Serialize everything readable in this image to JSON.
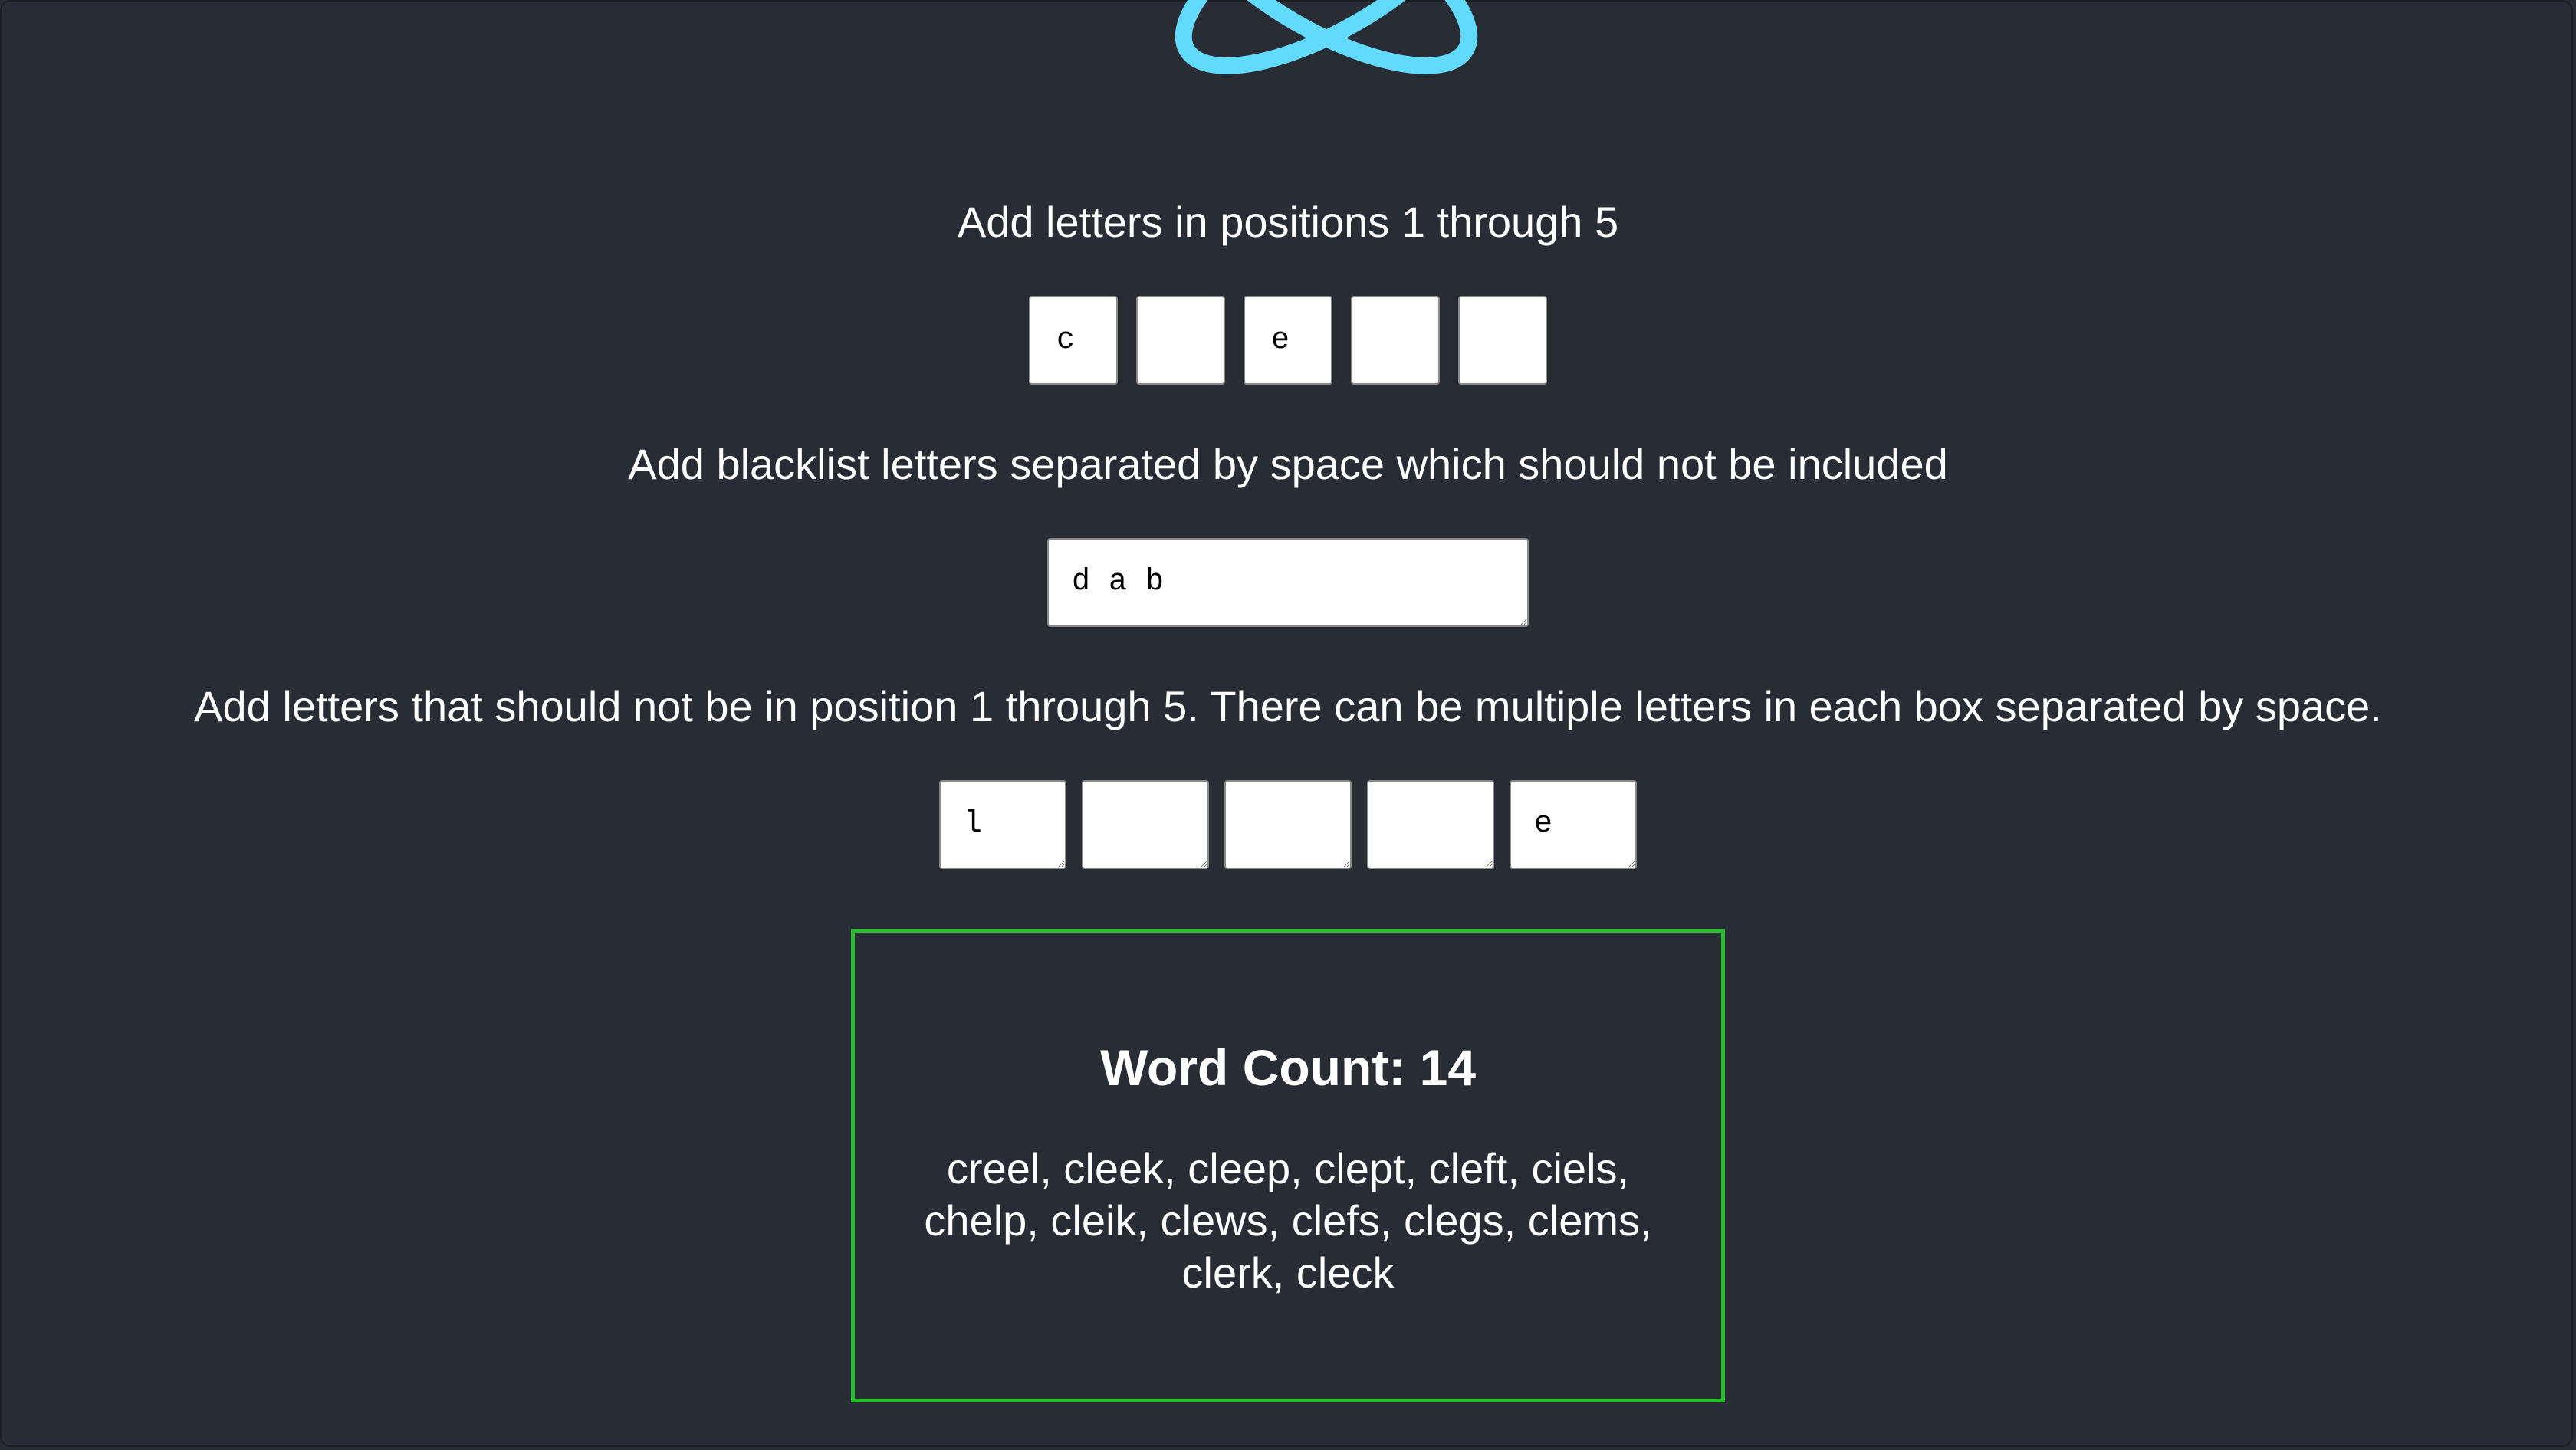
{
  "logo": {
    "icon": "react-atom-icon",
    "color": "#61dafb"
  },
  "positions": {
    "label": "Add letters in positions 1 through 5",
    "values": [
      "c",
      "",
      "e",
      "",
      ""
    ]
  },
  "blacklist": {
    "label": "Add blacklist letters separated by space which should not be included",
    "value": "d a b"
  },
  "exclusions": {
    "label": "Add letters that should not be in position 1 through 5. There can be multiple letters in each box separated by space.",
    "values": [
      "l",
      "",
      "",
      "",
      "e"
    ]
  },
  "result": {
    "title": "Word Count: 14",
    "words": "creel, cleek, cleep, clept, cleft, ciels, chelp, cleik, clews, clefs, clegs, clems, clerk, cleck",
    "border_color": "#2bbd30"
  }
}
